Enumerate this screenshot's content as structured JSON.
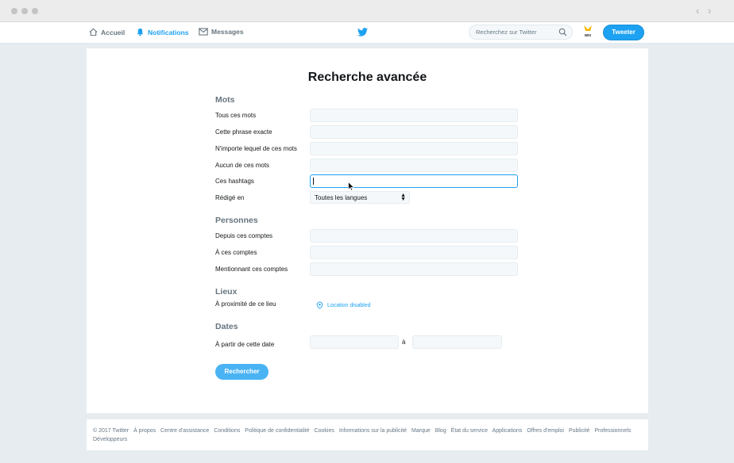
{
  "nav": {
    "home": "Accueil",
    "notifications": "Notifications",
    "messages": "Messages",
    "search_placeholder": "Recherchez sur Twitter",
    "tweet_button": "Tweeter",
    "avatar_text": "WIX"
  },
  "page": {
    "title": "Recherche avancée",
    "sections": {
      "words": "Mots",
      "people": "Personnes",
      "places": "Lieux",
      "dates": "Dates"
    },
    "labels": {
      "all_words": "Tous ces mots",
      "exact_phrase": "Cette phrase exacte",
      "any_words": "N'importe lequel de ces mots",
      "none_words": "Aucun de ces mots",
      "hashtags": "Ces hashtags",
      "written_in": "Rédigé en",
      "from_accounts": "Depuis ces comptes",
      "to_accounts": "À ces comptes",
      "mentioning": "Mentionnant ces comptes",
      "near_place": "À proximité de ce lieu",
      "from_date": "À partir de cette date"
    },
    "language_value": "Toutes les langues",
    "location_status": "Location disabled",
    "date_separator": "à",
    "submit": "Rechercher"
  },
  "footer": {
    "links": [
      "© 2017 Twitter",
      "À propos",
      "Centre d'assistance",
      "Conditions",
      "Politique de confidentialité",
      "Cookies",
      "Informations sur la publicité",
      "Marque",
      "Blog",
      "État du service",
      "Applications",
      "Offres d'emploi",
      "Publicité",
      "Professionnels",
      "Développeurs"
    ]
  },
  "colors": {
    "accent": "#1da1f2",
    "background": "#e6ecf0",
    "section_heading": "#66757f"
  }
}
